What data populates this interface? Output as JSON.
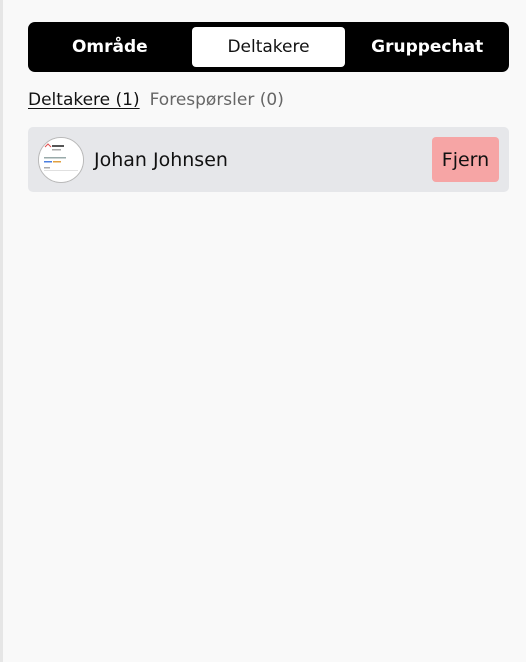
{
  "tabs": [
    {
      "label": "Område",
      "active": false
    },
    {
      "label": "Deltakere",
      "active": true
    },
    {
      "label": "Gruppechat",
      "active": false
    }
  ],
  "subtabs": {
    "participants": "Deltakere (1)",
    "requests": "Forespørsler (0)"
  },
  "participants": [
    {
      "name": "Johan Johnsen",
      "remove_label": "Fjern"
    }
  ],
  "colors": {
    "tabbar_bg": "#000000",
    "row_bg": "#e6e7ea",
    "remove_bg": "#f6a5a5"
  }
}
